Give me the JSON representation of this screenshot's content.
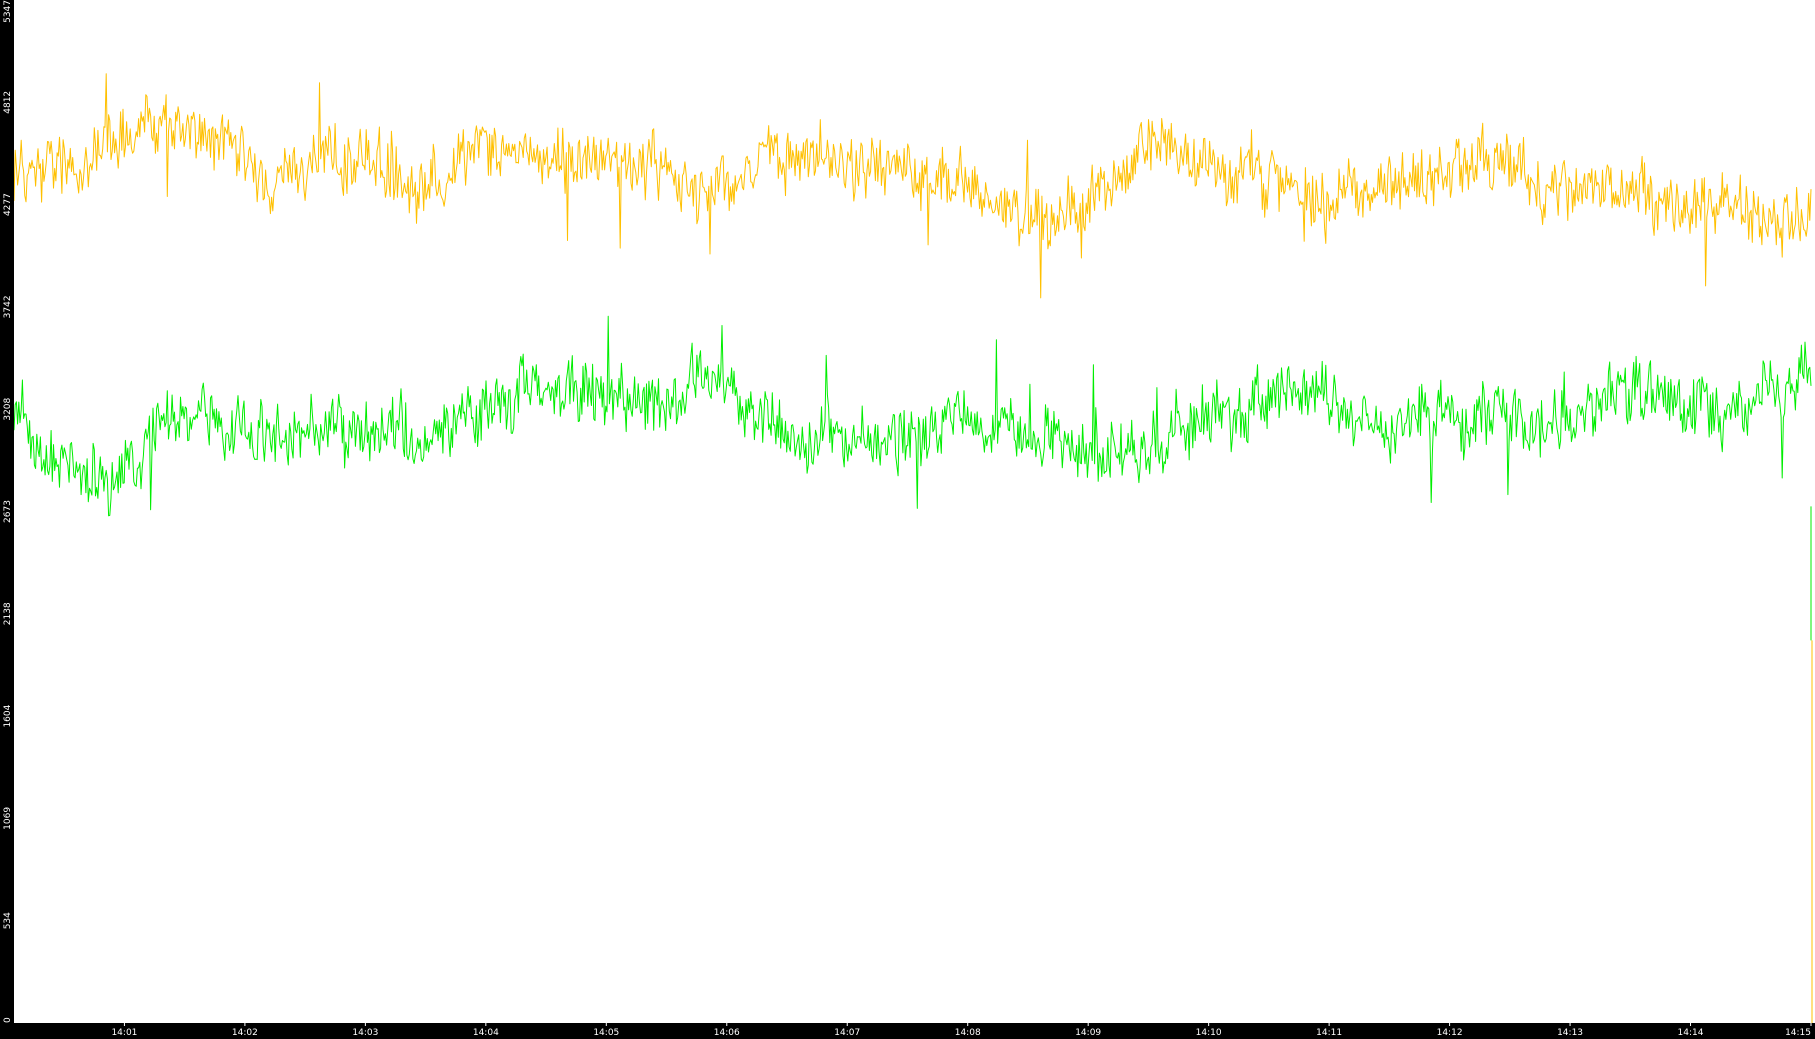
{
  "chart_data": {
    "type": "line",
    "title": "",
    "xlabel": "",
    "ylabel": "",
    "y_ticks": [
      "0",
      "534",
      "1069",
      "1604",
      "2138",
      "2673",
      "3208",
      "3742",
      "4277",
      "4812",
      "5347"
    ],
    "ylim": [
      0,
      5347
    ],
    "x_ticks": [
      "14:01",
      "14:02",
      "14:03",
      "14:04",
      "14:05",
      "14:06",
      "14:07",
      "14:08",
      "14:09",
      "14:10",
      "14:11",
      "14:12",
      "14:13",
      "14:14",
      "14:15"
    ],
    "x_range": [
      "14:00:05",
      "14:15:00"
    ],
    "grid": false,
    "legend": "none",
    "colors": {
      "background": "#ffffff",
      "axis_frame": "#000000",
      "axis_text": "#ffffff",
      "series_upper": "#ffc000",
      "series_lower": "#00ee00"
    },
    "series": [
      {
        "color": "#ffc000",
        "x": [
          "14:00:05",
          "14:00:30",
          "14:01:00",
          "14:01:25",
          "14:01:50",
          "14:02:15",
          "14:02:30",
          "14:03:00",
          "14:03:30",
          "14:04:00",
          "14:04:20",
          "14:04:40",
          "14:05:00",
          "14:05:25",
          "14:05:50",
          "14:06:15",
          "14:06:40",
          "14:07:00",
          "14:07:30",
          "14:08:00",
          "14:08:20",
          "14:08:40",
          "14:09:00",
          "14:09:20",
          "14:09:40",
          "14:10:00",
          "14:10:30",
          "14:11:00",
          "14:11:30",
          "14:12:00",
          "14:12:20",
          "14:12:40",
          "14:13:00",
          "14:13:30",
          "14:14:00",
          "14:14:20",
          "14:14:40",
          "14:15:00"
        ],
        "y": [
          4480,
          4450,
          4650,
          4700,
          4620,
          4350,
          4480,
          4520,
          4400,
          4600,
          4550,
          4500,
          4480,
          4450,
          4380,
          4500,
          4540,
          4470,
          4450,
          4360,
          4320,
          4200,
          4260,
          4520,
          4560,
          4480,
          4420,
          4320,
          4380,
          4420,
          4580,
          4380,
          4400,
          4340,
          4240,
          4300,
          4170,
          4200
        ]
      },
      {
        "color": "#00ee00",
        "x": [
          "14:00:05",
          "14:00:30",
          "14:01:00",
          "14:01:25",
          "14:01:50",
          "14:02:15",
          "14:02:30",
          "14:03:00",
          "14:03:30",
          "14:04:00",
          "14:04:20",
          "14:04:40",
          "14:05:00",
          "14:05:25",
          "14:05:50",
          "14:06:15",
          "14:06:40",
          "14:07:00",
          "14:07:30",
          "14:08:00",
          "14:08:20",
          "14:08:40",
          "14:09:00",
          "14:09:20",
          "14:09:40",
          "14:10:00",
          "14:10:30",
          "14:11:00",
          "14:11:30",
          "14:12:00",
          "14:12:20",
          "14:12:40",
          "14:13:00",
          "14:13:30",
          "14:14:00",
          "14:14:20",
          "14:14:40",
          "14:15:00"
        ],
        "y": [
          3200,
          2920,
          2850,
          3150,
          3100,
          3030,
          3100,
          3120,
          3020,
          3210,
          3330,
          3290,
          3270,
          3240,
          3380,
          3180,
          3080,
          3050,
          3060,
          3150,
          3080,
          3050,
          2950,
          2980,
          3060,
          3180,
          3210,
          3240,
          3130,
          3180,
          3200,
          3160,
          3120,
          3320,
          3250,
          3130,
          3340,
          3350
        ]
      }
    ]
  }
}
